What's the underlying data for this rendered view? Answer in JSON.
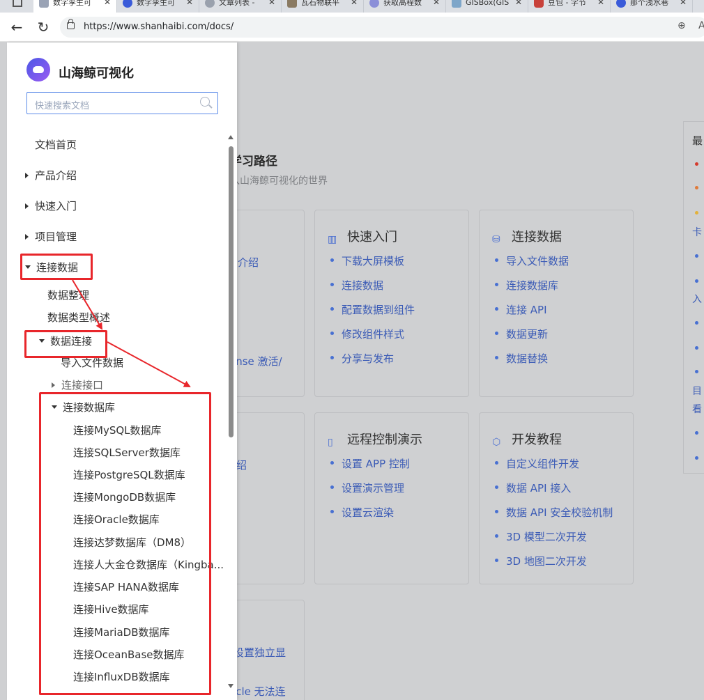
{
  "browser": {
    "tabs": [
      {
        "title": "数字孪生可",
        "active": true
      },
      {
        "title": "数字孪生可",
        "active": false
      },
      {
        "title": "文章列表 -",
        "active": false
      },
      {
        "title": "瓦石物联平",
        "active": false
      },
      {
        "title": "获取高程数",
        "active": false
      },
      {
        "title": "GISBox(GIS",
        "active": false
      },
      {
        "title": "豆包 - 字节",
        "active": false
      },
      {
        "title": "那个浅水巷",
        "active": false
      }
    ],
    "url": "https://www.shanhaibi.com/docs/"
  },
  "sidebar": {
    "brand": "山海鲸可视化",
    "search_placeholder": "快速搜索文档",
    "items": [
      {
        "label": "文档首页"
      },
      {
        "label": "产品介绍"
      },
      {
        "label": "快速入门"
      },
      {
        "label": "项目管理"
      },
      {
        "label": "连接数据"
      },
      {
        "label": "数据整理"
      },
      {
        "label": "数据类型概述"
      },
      {
        "label": "数据连接"
      },
      {
        "label": "导入文件数据"
      },
      {
        "label": "连接接口"
      },
      {
        "label": "连接数据库"
      },
      {
        "label": "连接MySQL数据库"
      },
      {
        "label": "连接SQLServer数据库"
      },
      {
        "label": "连接PostgreSQL数据库"
      },
      {
        "label": "连接MongoDB数据库"
      },
      {
        "label": "连接Oracle数据库"
      },
      {
        "label": "连接达梦数据库（DM8）"
      },
      {
        "label": "连接人大金仓数据库（Kingba..."
      },
      {
        "label": "连接SAP HANA数据库"
      },
      {
        "label": "连接Hive数据库"
      },
      {
        "label": "连接MariaDB数据库"
      },
      {
        "label": "连接OceanBase数据库"
      },
      {
        "label": "连接InfluxDB数据库"
      }
    ]
  },
  "main": {
    "path_title": "学习路径",
    "path_subtitle": "入山海鲸可视化的世界",
    "cards": [
      {
        "title": "快速入门",
        "icon": "book-icon",
        "links": [
          "下载大屏模板",
          "连接数据",
          "配置数据到组件",
          "修改组件样式",
          "分享与发布"
        ]
      },
      {
        "title": "连接数据",
        "icon": "database-icon",
        "links": [
          "导入文件数据",
          "连接数据库",
          "连接 API",
          "数据更新",
          "数据替换"
        ]
      },
      {
        "title": "远程控制演示",
        "icon": "tablet-icon",
        "links": [
          "设置 APP 控制",
          "设置演示管理",
          "设置云渲染"
        ]
      },
      {
        "title": "开发教程",
        "icon": "js-icon",
        "links": [
          "自定义组件开发",
          "数据 API 接入",
          "数据 API 安全校验机制",
          "3D 模型二次开发",
          "3D 地图二次开发"
        ]
      }
    ],
    "partial": {
      "c1_a": "介绍",
      "c1_b": "ense 激活/",
      "c4_a": "绍",
      "c7_a": "设置独立显",
      "c7_b": "acle 无法连"
    },
    "rail_title": "最",
    "rail_fragments": [
      "卡",
      "入",
      "目",
      "看"
    ]
  },
  "colors": {
    "annotation": "#e8262b",
    "link": "#3b5bb6",
    "accent": "#4870d2"
  }
}
